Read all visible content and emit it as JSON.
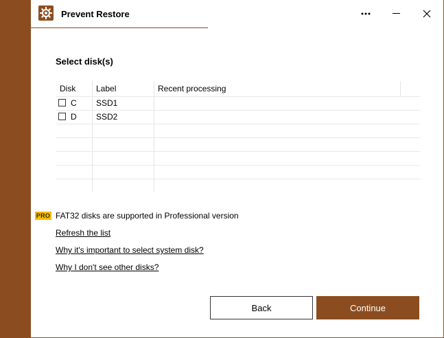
{
  "window": {
    "title": "Prevent Restore",
    "more_icon": "more-dots-icon",
    "min_icon": "minimize-icon",
    "close_icon": "close-icon"
  },
  "heading": "Select disk(s)",
  "table": {
    "columns": [
      "Disk",
      "Label",
      "Recent processing"
    ],
    "rows": [
      {
        "disk": "C",
        "label": "SSD1",
        "recent": "",
        "checked": false
      },
      {
        "disk": "D",
        "label": "SSD2",
        "recent": "",
        "checked": false
      }
    ]
  },
  "pro_notice": {
    "badge": "PRO",
    "text": "FAT32 disks are supported in Professional version"
  },
  "links": {
    "refresh": "Refresh the list",
    "why_system": "Why it's important to select system disk?",
    "why_other": "Why I don't see other disks?"
  },
  "buttons": {
    "back": "Back",
    "continue": "Continue"
  },
  "colors": {
    "accent": "#8B4D1F",
    "pro_badge": "#F4BE00"
  }
}
